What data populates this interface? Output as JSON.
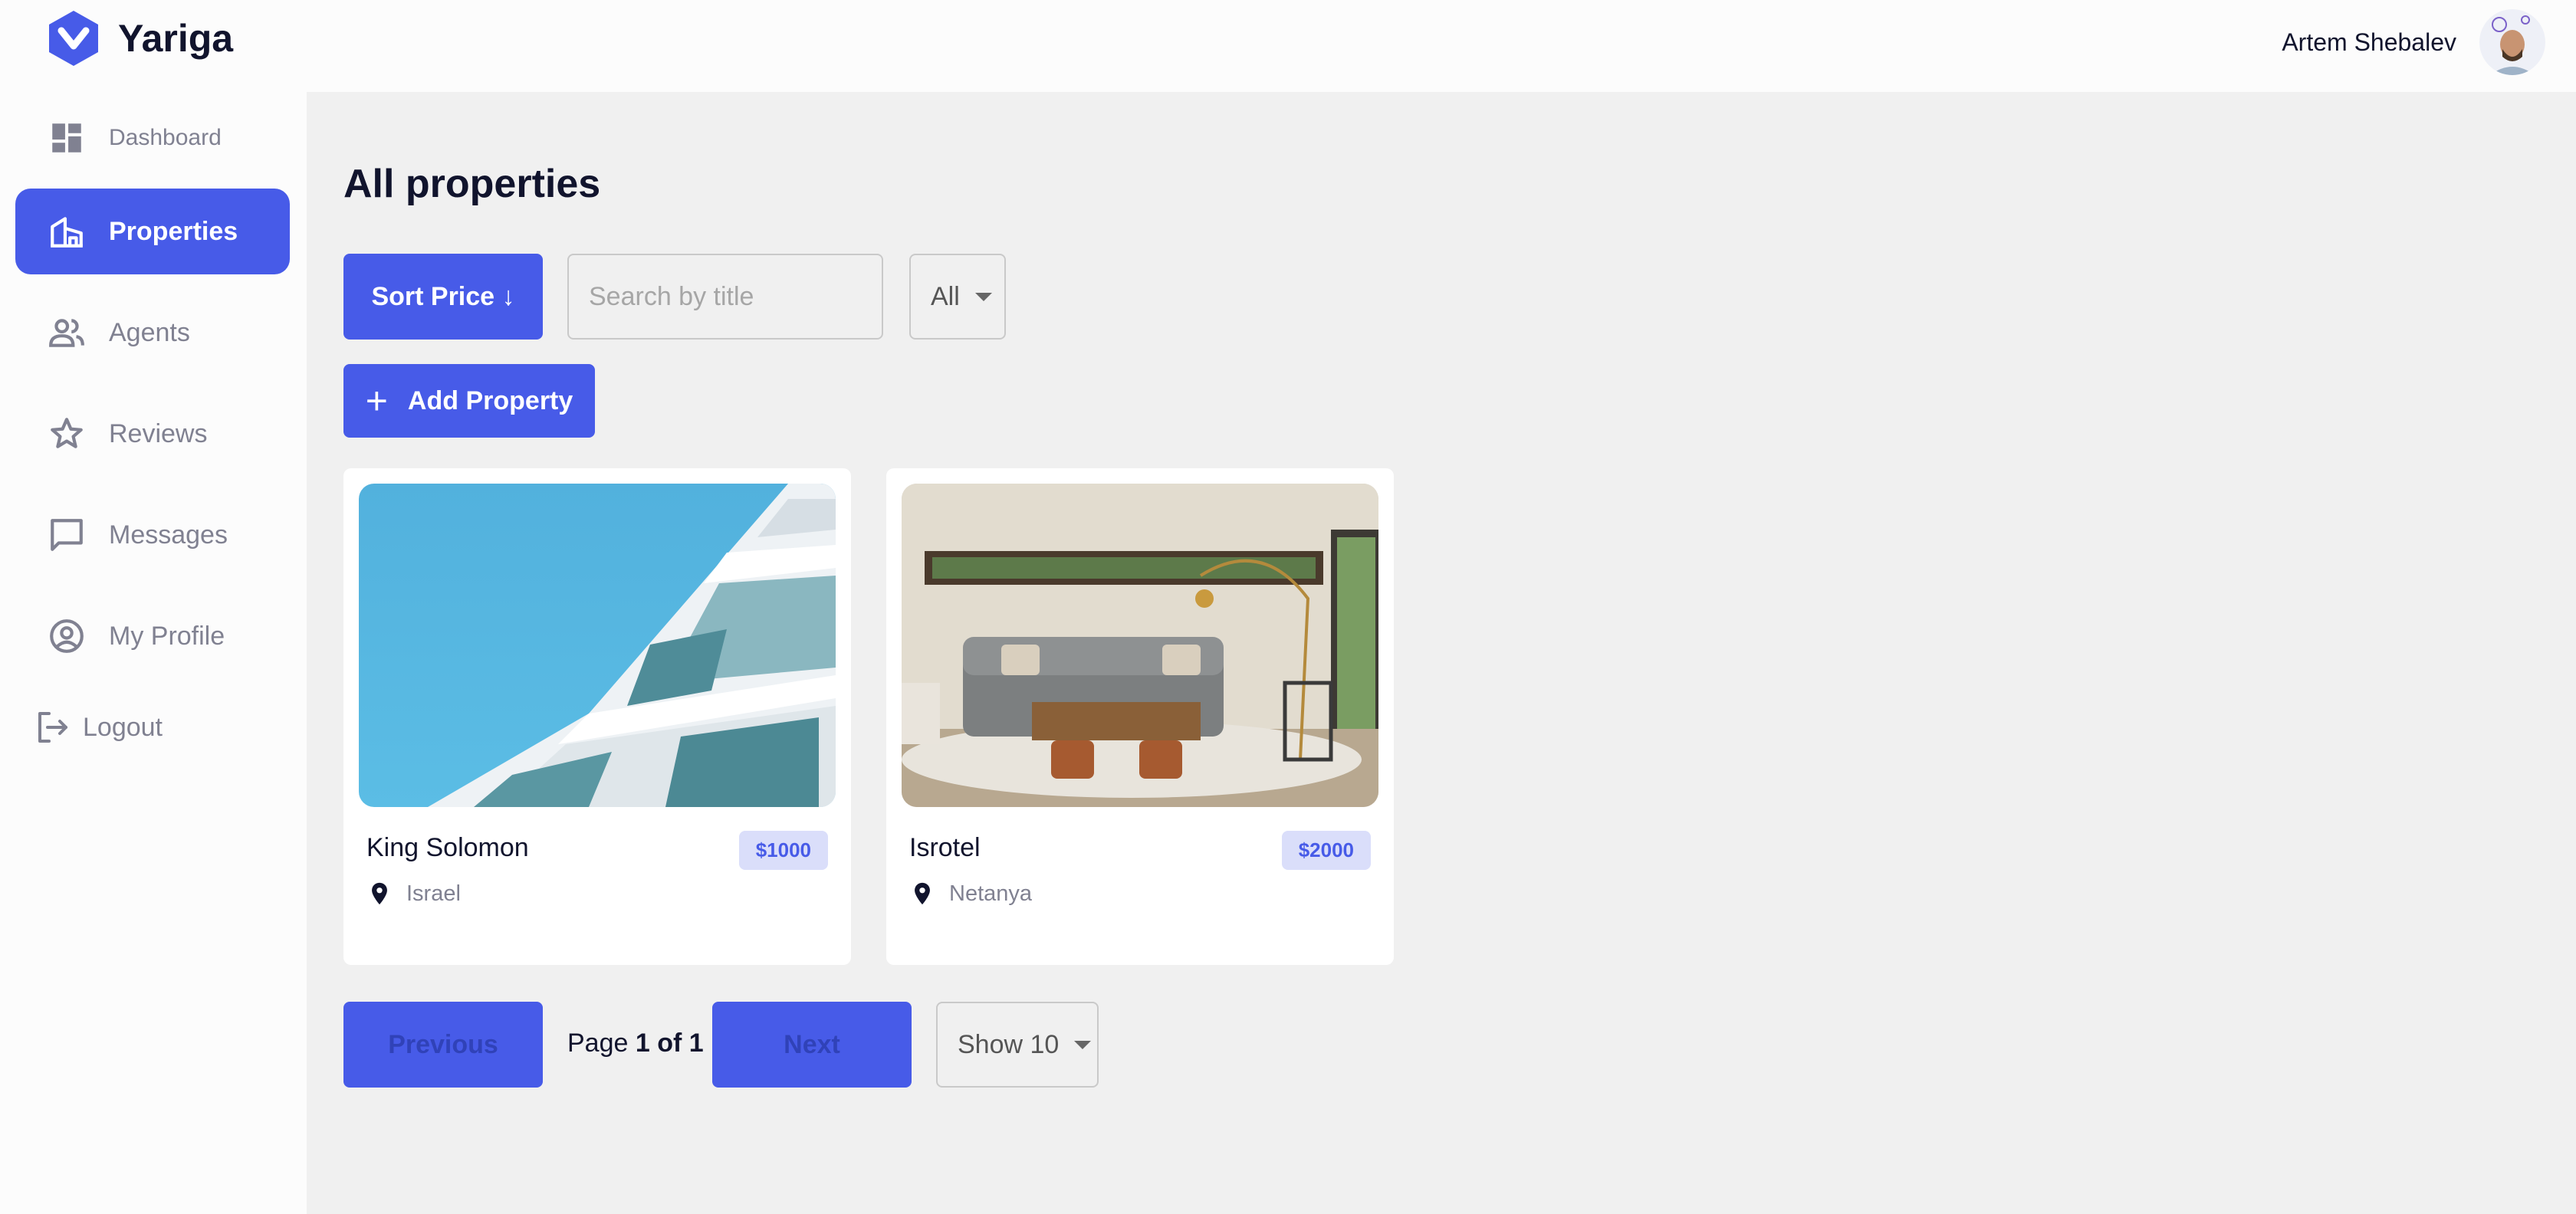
{
  "app": {
    "name": "Yariga"
  },
  "user": {
    "name": "Artem Shebalev"
  },
  "sidebar": {
    "items": [
      {
        "label": "Dashboard"
      },
      {
        "label": "Properties"
      },
      {
        "label": "Agents"
      },
      {
        "label": "Reviews"
      },
      {
        "label": "Messages"
      },
      {
        "label": "My Profile"
      }
    ],
    "active": "Properties",
    "logout": "Logout"
  },
  "main": {
    "title": "All properties",
    "sort_label": "Sort Price ↓",
    "search_placeholder": "Search by title",
    "search_value": "",
    "type_filter": "All",
    "add_label": "Add Property"
  },
  "properties": [
    {
      "title": "King Solomon",
      "price": "$1000",
      "location": "Israel",
      "image": "building-photo"
    },
    {
      "title": "Isrotel",
      "price": "$2000",
      "location": "Netanya",
      "image": "living-room-photo"
    }
  ],
  "pagination": {
    "previous": "Previous",
    "page_prefix": "Page",
    "page_value": "1 of 1",
    "next": "Next",
    "page_size": "Show 10"
  },
  "colors": {
    "accent": "#475be8",
    "price_bg": "#dadefa",
    "muted": "#808191",
    "text": "#11142d"
  }
}
